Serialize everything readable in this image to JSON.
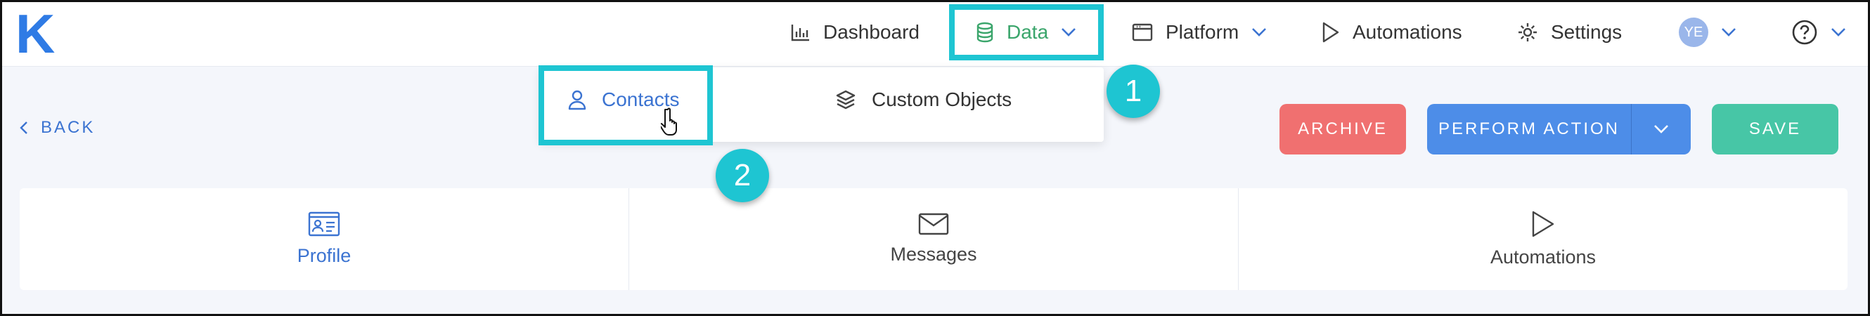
{
  "logo": "K",
  "nav": {
    "dashboard": "Dashboard",
    "data": "Data",
    "platform": "Platform",
    "automations": "Automations",
    "settings": "Settings",
    "avatar_initials": "YE"
  },
  "data_menu": {
    "contacts": "Contacts",
    "custom_objects": "Custom Objects"
  },
  "page": {
    "back": "BACK",
    "archive": "ARCHIVE",
    "perform_action": "PERFORM ACTION",
    "save": "SAVE"
  },
  "tabs": {
    "profile": "Profile",
    "messages": "Messages",
    "automations": "Automations"
  },
  "callouts": {
    "one": "1",
    "two": "2"
  },
  "colors": {
    "brand": "#2f7be5",
    "data_active": "#3aa56b",
    "highlight": "#1ec5d2",
    "archive": "#f07070",
    "perform": "#4d8de8",
    "save": "#47c6a6"
  }
}
